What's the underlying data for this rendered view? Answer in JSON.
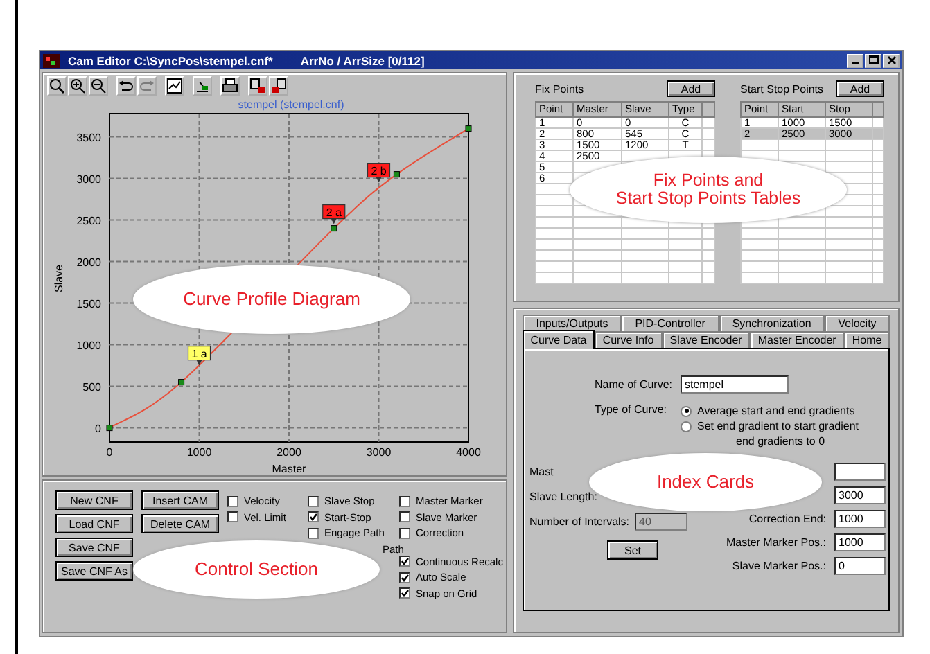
{
  "window": {
    "title": "Cam Editor C:\\SyncPos\\stempel.cnf*",
    "info": "ArrNo / ArrSize [0/112]"
  },
  "toolbar": [
    {
      "kind": "zoom-fit",
      "disabled": false
    },
    {
      "kind": "zoom-in",
      "disabled": false
    },
    {
      "kind": "zoom-out",
      "disabled": false
    },
    {
      "kind": "undo",
      "disabled": false
    },
    {
      "kind": "redo",
      "disabled": true
    },
    {
      "kind": "chart",
      "disabled": false
    },
    {
      "kind": "export",
      "disabled": false
    },
    {
      "kind": "print",
      "disabled": false
    },
    {
      "kind": "cam-delete",
      "disabled": false
    },
    {
      "kind": "cam-insert",
      "disabled": false
    }
  ],
  "chart": {
    "title": "stempel (stempel.cnf)",
    "callout": "Curve Profile Diagram",
    "tags": [
      {
        "color": "#ffff66"
      },
      {
        "color": "#ff1a1a"
      },
      {
        "color": "#ff1a1a"
      }
    ],
    "chart_data": {
      "type": "line",
      "xlabel": "Master",
      "ylabel": "Slave",
      "x": [
        0,
        800,
        2500,
        3200,
        4000
      ],
      "series": [
        {
          "color": "#e8503c",
          "marker": true,
          "values": [
            0,
            550,
            2400,
            3050,
            3600
          ]
        }
      ],
      "xlim": [
        0,
        4000
      ],
      "ylim": [
        -170,
        3780
      ],
      "xticks": [
        0,
        1000,
        2000,
        3000,
        4000
      ],
      "yticks": [
        0,
        500,
        1000,
        1500,
        2000,
        2500,
        3000,
        3500
      ],
      "grid": true,
      "annotations": [
        {
          "text": "1 a",
          "x": 1000,
          "y": 750
        },
        {
          "text": "2 a",
          "x": 2500,
          "y": 2450
        },
        {
          "text": "2 b",
          "x": 3000,
          "y": 2950
        }
      ]
    }
  },
  "controls": {
    "callout": "Control Section",
    "button_columns": [
      [
        "New CNF",
        "Load CNF",
        "Save CNF",
        "Save CNF As"
      ],
      [
        "Insert CAM",
        "Delete CAM"
      ]
    ],
    "checkbox_columns": [
      [
        [
          {
            "kind": "checkbox",
            "label": "Velocity",
            "checked": false
          },
          {
            "kind": "checkbox",
            "label": "Vel. Limit",
            "checked": false
          }
        ]
      ],
      [
        [
          {
            "kind": "checkbox",
            "label": "Slave Stop",
            "checked": false
          },
          {
            "kind": "checkbox",
            "label": "Start-Stop",
            "checked": true
          },
          {
            "kind": "checkbox",
            "label": "Engage Path",
            "checked": false
          },
          {
            "kind": "partial",
            "label": "Path"
          }
        ]
      ],
      [
        [
          {
            "kind": "checkbox",
            "label": "Master Marker",
            "checked": false
          },
          {
            "kind": "checkbox",
            "label": "Slave Marker",
            "checked": false
          },
          {
            "kind": "checkbox",
            "label": "Correction",
            "checked": false
          }
        ],
        [
          {
            "kind": "checkbox",
            "label": "Continuous Recalc",
            "checked": true
          },
          {
            "kind": "checkbox",
            "label": "Auto Scale",
            "checked": true
          },
          {
            "kind": "checkbox",
            "label": "Snap on Grid",
            "checked": true
          }
        ]
      ]
    ]
  },
  "fix_points": {
    "title": "Fix Points",
    "add": "Add",
    "columns": [
      "Point",
      "Master",
      "Slave",
      "Type"
    ],
    "rows": [
      {
        "cells": [
          "1",
          "0",
          "0",
          "C"
        ]
      },
      {
        "cells": [
          "2",
          "800",
          "545",
          "C"
        ]
      },
      {
        "cells": [
          "3",
          "1500",
          "1200",
          "T"
        ]
      },
      {
        "cells": [
          "4",
          "2500"
        ]
      },
      {
        "cells": [
          "5"
        ]
      },
      {
        "cells": [
          "6"
        ]
      }
    ]
  },
  "start_stop": {
    "title": "Start Stop Points",
    "add": "Add",
    "columns": [
      "Point",
      "Start",
      "Stop"
    ],
    "rows": [
      {
        "cells": [
          "1",
          "1000",
          "1500"
        ],
        "selected": false
      },
      {
        "cells": [
          "2",
          "2500",
          "3000"
        ],
        "selected": true
      }
    ]
  },
  "tables_callout": "Fix Points and\nStart Stop Points Tables",
  "index": {
    "callout": "Index Cards",
    "tab_rows": [
      [
        {
          "label": "Inputs/Outputs",
          "selected": false
        },
        {
          "label": "PID-Controller",
          "selected": false
        },
        {
          "label": "Synchronization",
          "selected": false
        },
        {
          "label": "Velocity",
          "selected": false
        }
      ],
      [
        {
          "label": "Curve Data",
          "selected": true
        },
        {
          "label": "Curve Info",
          "selected": false
        },
        {
          "label": "Slave Encoder",
          "selected": false
        },
        {
          "label": "Master Encoder",
          "selected": false
        },
        {
          "label": "Home",
          "selected": false
        }
      ]
    ],
    "name_label": "Name of Curve:",
    "name_value": "stempel",
    "type_label": "Type of Curve:",
    "type_options": [
      {
        "label": "Average start and end gradients",
        "selected": true
      },
      {
        "label": "Set end gradient to start gradient",
        "selected": false
      },
      {
        "label": "end gradients to 0",
        "selected": false
      }
    ],
    "master_label": "Mast",
    "slave_length_label": "Slave Length:",
    "intervals_label": "Number of Intervals:",
    "intervals_value": "40",
    "set": "Set",
    "right_fields": [
      {
        "kind": "field"
      },
      {
        "kind": "field",
        "value": "3000"
      },
      {
        "kind": "labeled",
        "label": "Correction End:",
        "value": "1000"
      },
      {
        "kind": "labeled",
        "label": "Master Marker Pos.:",
        "value": "1000"
      },
      {
        "kind": "labeled",
        "label": "Slave Marker Pos.:",
        "value": "0"
      }
    ]
  }
}
